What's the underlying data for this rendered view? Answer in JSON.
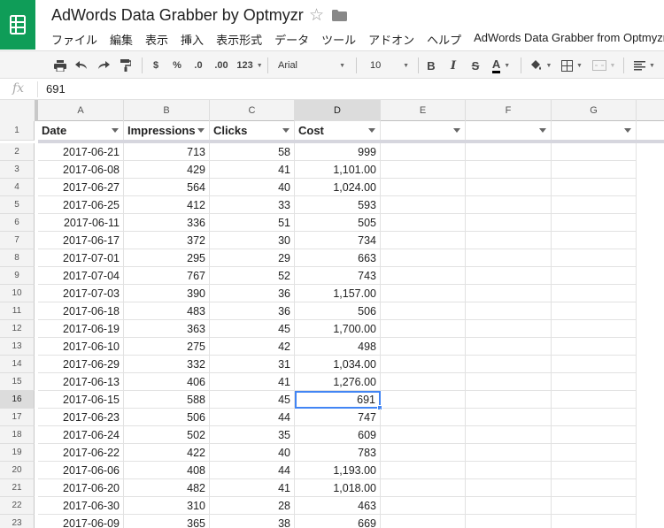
{
  "doc": {
    "title": "AdWords Data Grabber by Optmyzr"
  },
  "menu": [
    "ファイル",
    "編集",
    "表示",
    "挿入",
    "表示形式",
    "データ",
    "ツール",
    "アドオン",
    "ヘルプ",
    "AdWords Data Grabber from Optmyzr"
  ],
  "toolbar": {
    "currency": "$",
    "percent": "%",
    "decimal_decrease": ".0",
    "decimal_increase": ".00",
    "more_formats": "123",
    "font": "Arial",
    "font_size": "10",
    "bold": "B",
    "italic": "I",
    "strike": "S",
    "text_color": "A"
  },
  "formula": {
    "fx": "fx",
    "value": "691"
  },
  "columns": [
    "A",
    "B",
    "C",
    "D",
    "E",
    "F",
    "G"
  ],
  "header_row": {
    "num": "1",
    "cells": [
      "Date",
      "Impressions",
      "Clicks",
      "Cost"
    ]
  },
  "rows": [
    {
      "num": "2",
      "date": "2017-06-21",
      "impressions": "713",
      "clicks": "58",
      "cost": "999"
    },
    {
      "num": "3",
      "date": "2017-06-08",
      "impressions": "429",
      "clicks": "41",
      "cost": "1,101.00"
    },
    {
      "num": "4",
      "date": "2017-06-27",
      "impressions": "564",
      "clicks": "40",
      "cost": "1,024.00"
    },
    {
      "num": "5",
      "date": "2017-06-25",
      "impressions": "412",
      "clicks": "33",
      "cost": "593"
    },
    {
      "num": "6",
      "date": "2017-06-11",
      "impressions": "336",
      "clicks": "51",
      "cost": "505"
    },
    {
      "num": "7",
      "date": "2017-06-17",
      "impressions": "372",
      "clicks": "30",
      "cost": "734"
    },
    {
      "num": "8",
      "date": "2017-07-01",
      "impressions": "295",
      "clicks": "29",
      "cost": "663"
    },
    {
      "num": "9",
      "date": "2017-07-04",
      "impressions": "767",
      "clicks": "52",
      "cost": "743"
    },
    {
      "num": "10",
      "date": "2017-07-03",
      "impressions": "390",
      "clicks": "36",
      "cost": "1,157.00"
    },
    {
      "num": "11",
      "date": "2017-06-18",
      "impressions": "483",
      "clicks": "36",
      "cost": "506"
    },
    {
      "num": "12",
      "date": "2017-06-19",
      "impressions": "363",
      "clicks": "45",
      "cost": "1,700.00"
    },
    {
      "num": "13",
      "date": "2017-06-10",
      "impressions": "275",
      "clicks": "42",
      "cost": "498"
    },
    {
      "num": "14",
      "date": "2017-06-29",
      "impressions": "332",
      "clicks": "31",
      "cost": "1,034.00"
    },
    {
      "num": "15",
      "date": "2017-06-13",
      "impressions": "406",
      "clicks": "41",
      "cost": "1,276.00"
    },
    {
      "num": "16",
      "date": "2017-06-15",
      "impressions": "588",
      "clicks": "45",
      "cost": "691"
    },
    {
      "num": "17",
      "date": "2017-06-23",
      "impressions": "506",
      "clicks": "44",
      "cost": "747"
    },
    {
      "num": "18",
      "date": "2017-06-24",
      "impressions": "502",
      "clicks": "35",
      "cost": "609"
    },
    {
      "num": "19",
      "date": "2017-06-22",
      "impressions": "422",
      "clicks": "40",
      "cost": "783"
    },
    {
      "num": "20",
      "date": "2017-06-06",
      "impressions": "408",
      "clicks": "44",
      "cost": "1,193.00"
    },
    {
      "num": "21",
      "date": "2017-06-20",
      "impressions": "482",
      "clicks": "41",
      "cost": "1,018.00"
    },
    {
      "num": "22",
      "date": "2017-06-30",
      "impressions": "310",
      "clicks": "28",
      "cost": "463"
    },
    {
      "num": "23",
      "date": "2017-06-09",
      "impressions": "365",
      "clicks": "38",
      "cost": "669"
    }
  ],
  "selection": {
    "row": "16",
    "column": "D"
  },
  "colors": {
    "brand": "#0f9d58",
    "selection": "#4285f4"
  }
}
